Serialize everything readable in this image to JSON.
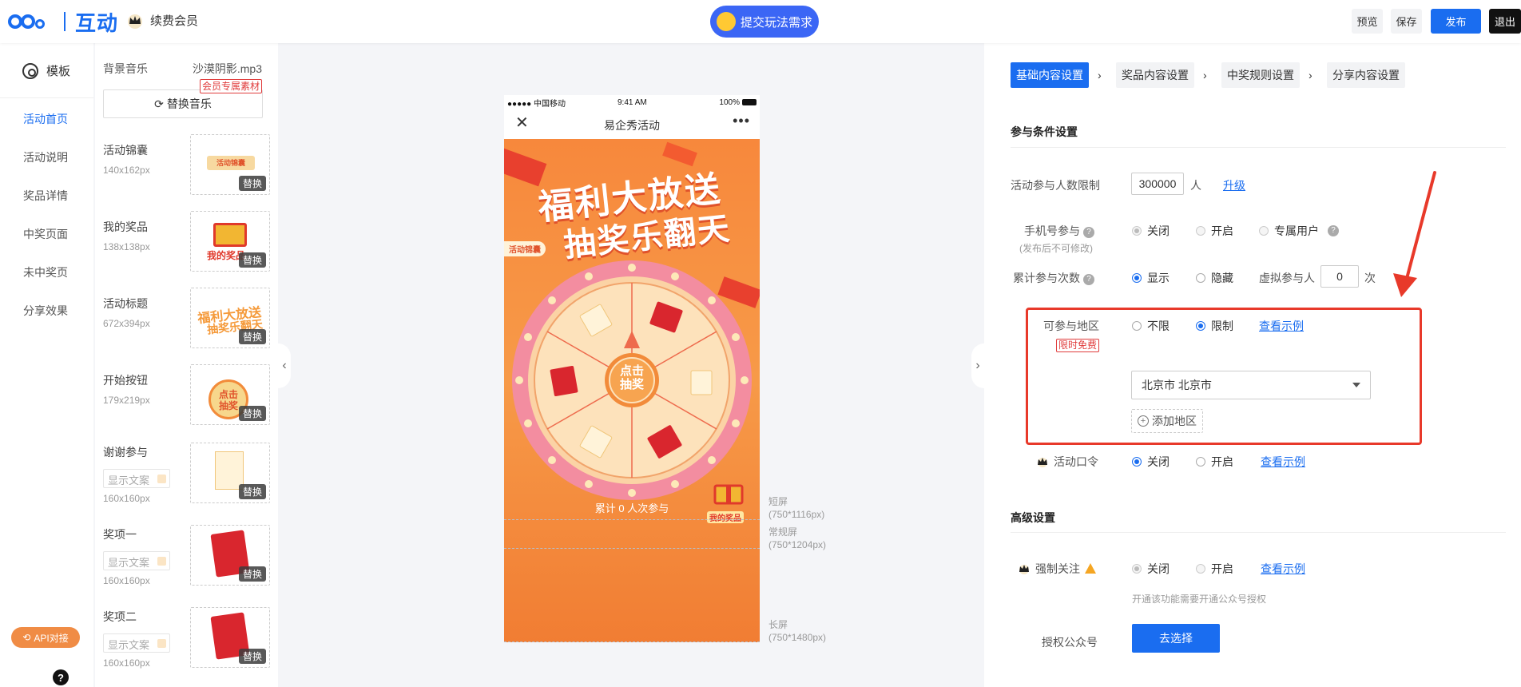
{
  "header": {
    "logo_text": "互动",
    "renew_label": "续费会员",
    "submit_label": "提交玩法需求",
    "preview_label": "预览",
    "save_label": "保存",
    "publish_label": "发布",
    "exit_label": "退出"
  },
  "leftnav": {
    "template_label": "模板",
    "items": [
      {
        "label": "活动首页",
        "active": true
      },
      {
        "label": "活动说明",
        "active": false
      },
      {
        "label": "奖品详情",
        "active": false
      },
      {
        "label": "中奖页面",
        "active": false
      },
      {
        "label": "未中奖页",
        "active": false
      },
      {
        "label": "分享效果",
        "active": false
      }
    ],
    "api_label": "API对接",
    "help_label": "?"
  },
  "resources": {
    "bgm_label": "背景音乐",
    "bgm_file": "沙漠阴影.mp3",
    "member_tag": "会员专属素材",
    "replace_music_label": "替换音乐",
    "swap_label": "替换",
    "text_placeholder": "显示文案",
    "items": [
      {
        "name": "活动锦囊",
        "size": "140x162px",
        "has_input": false
      },
      {
        "name": "我的奖品",
        "size": "138x138px",
        "has_input": false
      },
      {
        "name": "活动标题",
        "size": "672x394px",
        "has_input": false
      },
      {
        "name": "开始按钮",
        "size": "179x219px",
        "has_input": false
      },
      {
        "name": "谢谢参与",
        "size": "160x160px",
        "has_input": true
      },
      {
        "name": "奖项一",
        "size": "160x160px",
        "has_input": true
      },
      {
        "name": "奖项二",
        "size": "160x160px",
        "has_input": true
      }
    ]
  },
  "phone": {
    "carrier": "●●●●● 中国移动",
    "time": "9:41 AM",
    "battery": "100%",
    "title": "易企秀活动",
    "banner_line1": "福利大放送",
    "banner_line2": "抽奖乐翻天",
    "tip_tag": "活动锦囊",
    "start_label": "点击\n抽奖",
    "participants": "累计 0 人次参与",
    "my_prize": "我的奖品",
    "screens": [
      {
        "label": "短屏",
        "dims": "(750*1116px)"
      },
      {
        "label": "常规屏",
        "dims": "(750*1204px)"
      },
      {
        "label": "长屏",
        "dims": "(750*1480px)"
      }
    ]
  },
  "settings": {
    "steps": [
      "基础内容设置",
      "奖品内容设置",
      "中奖规则设置",
      "分享内容设置"
    ],
    "section1": "参与条件设置",
    "limit_label": "活动参与人数限制",
    "limit_value": "300000",
    "limit_unit": "人",
    "upgrade_label": "升级",
    "phone_label": "手机号参与",
    "phone_sub": "(发布后不可修改)",
    "opt_close": "关闭",
    "opt_open": "开启",
    "opt_exclusive": "专属用户",
    "count_label": "累计参与次数",
    "opt_show": "显示",
    "opt_hide": "隐藏",
    "virtual_label": "虚拟参与人",
    "virtual_value": "0",
    "virtual_unit": "次",
    "region_label": "可参与地区",
    "free_tag": "限时免费",
    "opt_unlimited": "不限",
    "opt_limited": "限制",
    "view_example": "查看示例",
    "region_value": "北京市 北京市",
    "add_region": "添加地区",
    "password_label": "活动口令",
    "section2": "高级设置",
    "follow_label": "强制关注",
    "follow_note": "开通该功能需要开通公众号授权",
    "auth_label": "授权公众号",
    "choose_label": "去选择"
  },
  "colors": {
    "accent": "#1a6df0",
    "highlight": "#e8392a",
    "canvas": "#f7883c"
  }
}
